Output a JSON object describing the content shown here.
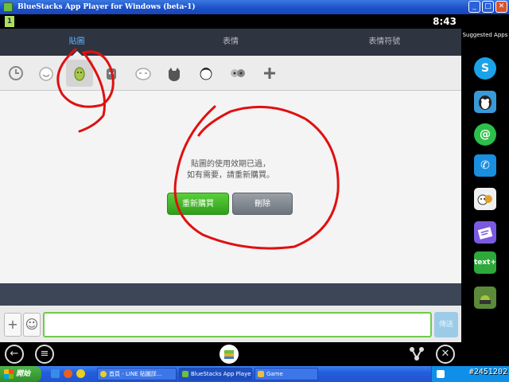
{
  "window": {
    "title": "BlueStacks App Player for Windows (beta-1)"
  },
  "statusbar": {
    "clock": "8:43",
    "notif": "1"
  },
  "tabs": [
    {
      "label": "貼圖",
      "active": true
    },
    {
      "label": "表情",
      "active": false
    },
    {
      "label": "表情符號",
      "active": false
    }
  ],
  "sticker_icons": [
    "recent-icon",
    "sticker-pack-1-icon",
    "sticker-pack-2-icon",
    "sticker-pack-3-icon",
    "sticker-pack-4-icon",
    "cat-sticker-icon",
    "hair-sticker-icon",
    "bear-sticker-icon",
    "add-icon"
  ],
  "message": {
    "line1": "貼圖的使用效期已過，",
    "line2": "如有需要，請重新購買。"
  },
  "buttons": {
    "buy": "重新購買",
    "delete": "刪除"
  },
  "input": {
    "plus": "+",
    "emoji": "☺",
    "send": "傳送"
  },
  "sidebar": {
    "title": "Suggested Apps",
    "apps": [
      "skype-icon",
      "penguin-game-icon",
      "at-sign-app-icon",
      "phone-app-icon",
      "sticker-app-icon",
      "notes-app-icon",
      "text-plus-icon",
      "android-icon"
    ],
    "text_plus": "text+"
  },
  "taskbar": {
    "start": "開始",
    "tasks": [
      "首頁 - LINE 貼圖詳...",
      "BlueStacks App Player...",
      "Game"
    ]
  },
  "watermark": "#2451202",
  "colors": {
    "accent_green": "#3db825",
    "tab_active": "#5eb4ff",
    "annotation_red": "#e01010"
  }
}
